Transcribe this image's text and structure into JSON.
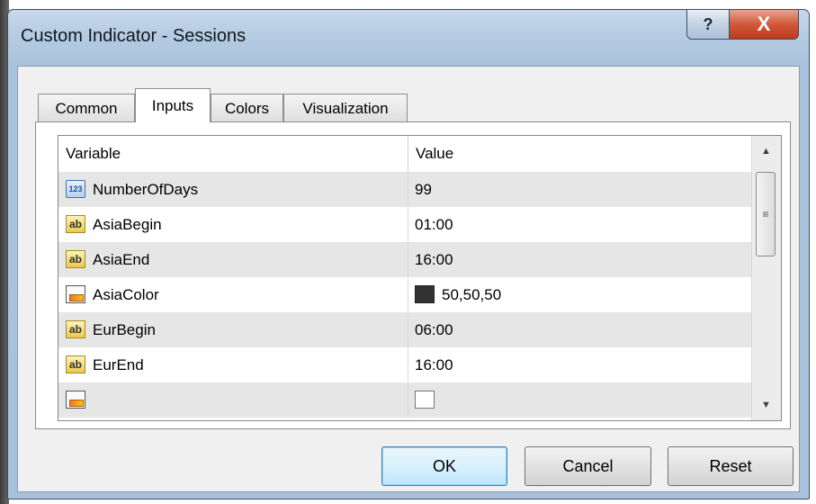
{
  "window": {
    "title": "Custom Indicator - Sessions",
    "help_glyph": "?",
    "close_glyph": "X"
  },
  "tabs": [
    {
      "label": "Common",
      "active": false
    },
    {
      "label": "Inputs",
      "active": true
    },
    {
      "label": "Colors",
      "active": false
    },
    {
      "label": "Visualization",
      "active": false
    }
  ],
  "grid": {
    "columns": [
      "Variable",
      "Value"
    ],
    "rows": [
      {
        "variable": "NumberOfDays",
        "value": "99",
        "icon": "numeric-123-icon",
        "icon_text": "123"
      },
      {
        "variable": "AsiaBegin",
        "value": "01:00",
        "icon": "string-ab-icon",
        "icon_text": "ab"
      },
      {
        "variable": "AsiaEnd",
        "value": "16:00",
        "icon": "string-ab-icon",
        "icon_text": "ab"
      },
      {
        "variable": "AsiaColor",
        "value": "50,50,50",
        "icon": "color-icon",
        "swatch": "#323232"
      },
      {
        "variable": "EurBegin",
        "value": "06:00",
        "icon": "string-ab-icon",
        "icon_text": "ab"
      },
      {
        "variable": "EurEnd",
        "value": "16:00",
        "icon": "string-ab-icon",
        "icon_text": "ab"
      }
    ]
  },
  "buttons": {
    "ok": "OK",
    "cancel": "Cancel",
    "reset": "Reset"
  },
  "colors": {
    "row_alt": "#e6e6e6",
    "ok_border": "#3c7fb1",
    "close_red": "#c74a2c"
  }
}
